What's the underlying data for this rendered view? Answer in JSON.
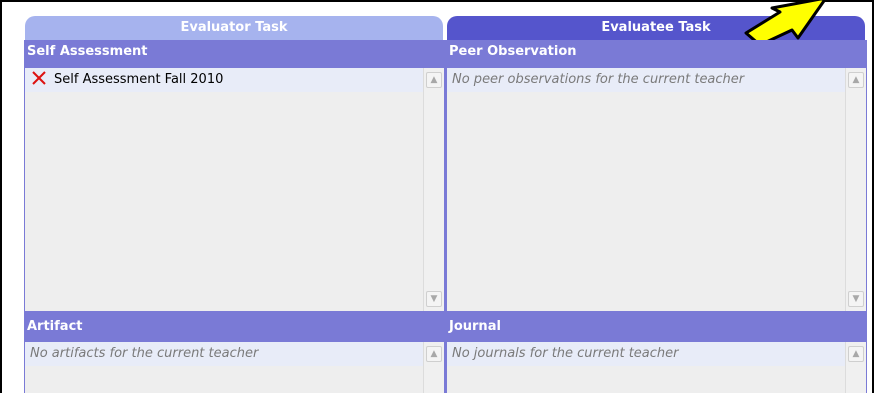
{
  "tabs": {
    "evaluator_label": "Evaluator Task",
    "evaluatee_label": "Evaluatee Task"
  },
  "panels": {
    "self_assessment": {
      "title": "Self Assessment",
      "items": [
        {
          "label": "Self Assessment Fall 2010",
          "icon": "delete-x-icon"
        }
      ]
    },
    "peer_observation": {
      "title": "Peer Observation",
      "empty_text": "No peer observations for the current teacher"
    },
    "artifact": {
      "title": "Artifact",
      "empty_text": "No artifacts for the current teacher"
    },
    "journal": {
      "title": "Journal",
      "empty_text": "No journals for the current teacher"
    }
  },
  "colors": {
    "tab_active": "#5555cc",
    "tab_inactive": "#a6b3ee",
    "panel_header": "#7a7ad6",
    "delete_icon": "#dd1111",
    "arrow": "#ffff00"
  }
}
